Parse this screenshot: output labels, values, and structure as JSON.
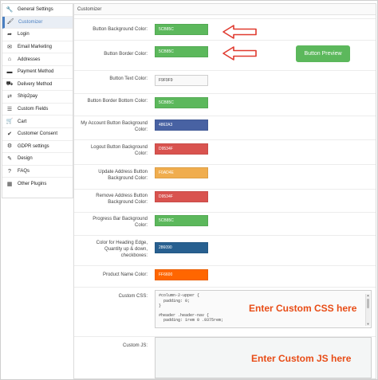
{
  "sidebar": {
    "items": [
      {
        "label": "General Settings",
        "icon": "wrench-icon",
        "glyph": "🔧",
        "active": false
      },
      {
        "label": "Customizer",
        "icon": "brush-icon",
        "glyph": "🖌",
        "active": true
      },
      {
        "label": "Login",
        "icon": "login-icon",
        "glyph": "➦",
        "active": false
      },
      {
        "label": "Email Marketing",
        "icon": "email-icon",
        "glyph": "✉",
        "active": false
      },
      {
        "label": "Addresses",
        "icon": "address-icon",
        "glyph": "⌂",
        "active": false
      },
      {
        "label": "Payment Method",
        "icon": "payment-icon",
        "glyph": "▬",
        "active": false
      },
      {
        "label": "Delivery Method",
        "icon": "delivery-icon",
        "glyph": "⛟",
        "active": false
      },
      {
        "label": "Ship2pay",
        "icon": "ship2pay-icon",
        "glyph": "⇄",
        "active": false
      },
      {
        "label": "Custom Fields",
        "icon": "custom-fields-icon",
        "glyph": "☰",
        "active": false
      },
      {
        "label": "Cart",
        "icon": "cart-icon",
        "glyph": "🛒",
        "active": false
      },
      {
        "label": "Customer Consent",
        "icon": "consent-icon",
        "glyph": "✔",
        "active": false
      },
      {
        "label": "GDPR settings",
        "icon": "gdpr-icon",
        "glyph": "⚙",
        "active": false
      },
      {
        "label": "Design",
        "icon": "design-icon",
        "glyph": "✎",
        "active": false
      },
      {
        "label": "FAQs",
        "icon": "faq-icon",
        "glyph": "?",
        "active": false
      },
      {
        "label": "Other Plugins",
        "icon": "plugins-icon",
        "glyph": "▦",
        "active": false
      }
    ]
  },
  "panel": {
    "title": "Customizer"
  },
  "rows": [
    {
      "label": "Button Background Color:",
      "value": "5CB85C",
      "color": "#5cb85c",
      "light": false
    },
    {
      "label": "Button Border Color:",
      "value": "5CB85C",
      "color": "#5cb85c",
      "light": false
    },
    {
      "label": "Button Text Color:",
      "value": "F9F9F9",
      "color": "#f9f9f9",
      "light": true
    },
    {
      "label": "Button Border Bottom Color:",
      "value": "5CB85C",
      "color": "#5cb85c",
      "light": false
    },
    {
      "label": "My Account Button Background Color:",
      "value": "4862A3",
      "color": "#4862a3",
      "light": false
    },
    {
      "label": "Logout Button Background Color:",
      "value": "D9534F",
      "color": "#d9534f",
      "light": false
    },
    {
      "label": "Update Address Button Background Color:",
      "value": "F0AD4E",
      "color": "#f0ad4e",
      "light": false
    },
    {
      "label": "Remove Address Button Background Color:",
      "value": "D9534F",
      "color": "#d9534f",
      "light": false
    },
    {
      "label": "Progress Bar Background Color:",
      "value": "5CB85C",
      "color": "#5cb85c",
      "light": false
    },
    {
      "label": "Color for Heading Edge, Quantity up & down, checkboxes:",
      "value": "286090",
      "color": "#286090",
      "light": false
    },
    {
      "label": "Product Name Color:",
      "value": "FF6600",
      "color": "#ff6600",
      "light": false
    }
  ],
  "preview_button": {
    "label": "Button Preview",
    "color": "#5cb85c"
  },
  "custom_css": {
    "label": "Custom CSS:",
    "code": [
      "#column-2-upper {",
      "  padding: 0;",
      "}",
      "",
      "#header .header-nav {",
      "  padding: 1rem 0 .9375rem;"
    ],
    "overlay": "Enter Custom CSS here"
  },
  "custom_js": {
    "label": "Custom JS:",
    "overlay": "Enter Custom JS here"
  },
  "colors": {
    "annotation": "#e84c16",
    "accent": "#4a7fc1",
    "arrow": "#e03a2f"
  }
}
